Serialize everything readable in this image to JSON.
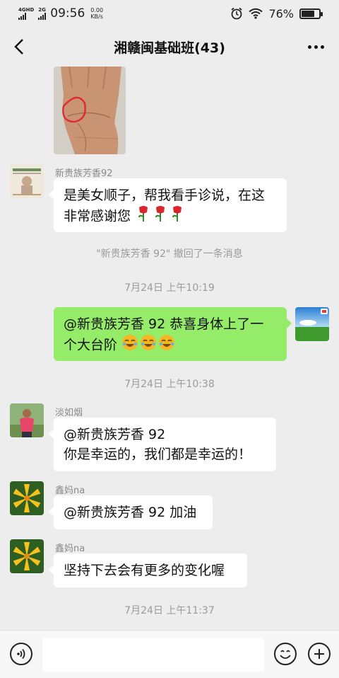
{
  "status_bar": {
    "network_1": "4G",
    "network_1_sub": "HD",
    "network_2": "2G",
    "time": "09:56",
    "speed_value": "0.00",
    "speed_unit": "KB/s",
    "battery": "76%",
    "battery_level": 0.76
  },
  "header": {
    "title": "湘赣闽基础班(43)"
  },
  "messages": [
    {
      "id": "m1",
      "sender": "新贵族芳香92",
      "text_line1": "是美女顺子，帮我看手诊说，在这",
      "text_line2": "非常感谢您",
      "emoji": "rose"
    },
    {
      "id": "sys1",
      "system": "\"新贵族芳香 92\" 撤回了一条消息"
    },
    {
      "id": "t1",
      "timestamp": "7月24日 上午10:19"
    },
    {
      "id": "m2",
      "self": true,
      "text_line1": "@新贵族芳香 92  恭喜身体上了一",
      "text_line2": "个大台阶",
      "emoji": "laugh-emoji"
    },
    {
      "id": "t2",
      "timestamp": "7月24日 上午10:38"
    },
    {
      "id": "m3",
      "sender": "淡如烟",
      "text_line1": "@新贵族芳香 92",
      "text_line2": "你是幸运的，我们都是幸运的！"
    },
    {
      "id": "m4",
      "sender": "鑫妈na",
      "text_line1": "@新贵族芳香 92  加油"
    },
    {
      "id": "m5",
      "sender": "鑫妈na",
      "text_line1": "坚持下去会有更多的变化喔"
    },
    {
      "id": "t3",
      "timestamp": "7月24日 上午11:37"
    }
  ],
  "input_bar": {
    "placeholder": "",
    "icons": [
      "voice-icon",
      "emoji-icon",
      "plus-icon"
    ]
  },
  "colors": {
    "background": "#ededed",
    "self_bubble": "#95ec69",
    "other_bubble": "#ffffff",
    "rose": "#d8262a"
  }
}
